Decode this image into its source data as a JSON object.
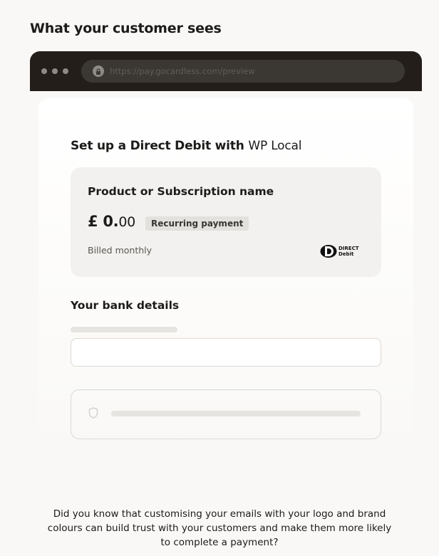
{
  "section": {
    "title": "What your customer sees"
  },
  "browser": {
    "url": "https://pay.gocardless.com/preview"
  },
  "checkout": {
    "setup_title": "Set up a Direct Debit with",
    "merchant_name": "WP Local",
    "product": {
      "name": "Product or Subscription name",
      "amount_main": "£ 0.",
      "amount_cents": "00",
      "badge": "Recurring payment",
      "billing": "Billed monthly",
      "logo_line1": "DIRECT",
      "logo_line2": "Debit"
    },
    "bank_details_title": "Your bank details"
  },
  "footer": {
    "text": "Did you know that customising your emails with your logo and brand colours can build trust with your customers and make them more likely to complete a payment?"
  },
  "colors": {
    "background": "#f9f8f6",
    "browser_bar": "#231e1a",
    "card_panel": "#f2f1ef",
    "badge": "#e3e1dd"
  }
}
